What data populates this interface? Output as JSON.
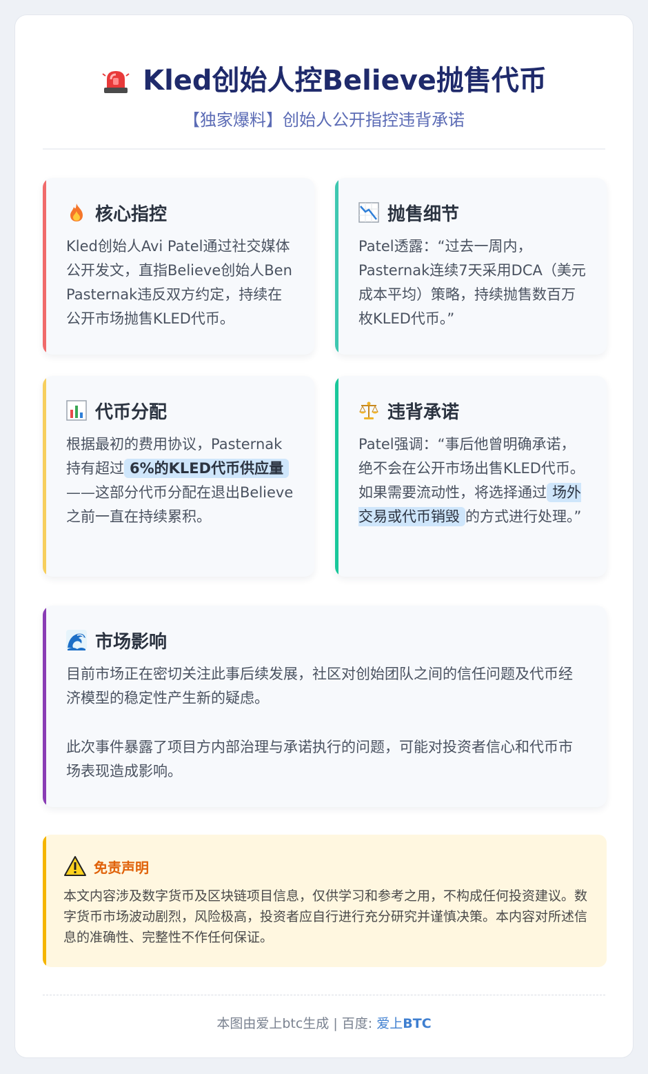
{
  "header": {
    "title": "Kled创始人控Believe抛售代币",
    "subtitle": "【独家爆料】创始人公开指控违背承诺"
  },
  "cards": {
    "accusation": {
      "title": "核心指控",
      "body": "Kled创始人Avi Patel通过社交媒体公开发文，直指Believe创始人Ben Pasternak违反双方约定，持续在公开市场抛售KLED代币。"
    },
    "selling": {
      "title": "抛售细节",
      "body": "Patel透露：“过去一周内，Pasternak连续7天采用DCA（美元成本平均）策略，持续抛售数百万枚KLED代币。”"
    },
    "allocation": {
      "title": "代币分配",
      "body_before": "根据最初的费用协议，Pasternak持有超过",
      "highlight": "6%的KLED代币供应量",
      "body_after": "——这部分代币分配在退出Believe之前一直在持续累积。"
    },
    "promise": {
      "title": "违背承诺",
      "body_before": "Patel强调：“事后他曾明确承诺，绝不会在公开市场出售KLED代币。如果需要流动性，将选择通过",
      "highlight": "场外交易或代币销毁",
      "body_after": "的方式进行处理。”"
    },
    "impact": {
      "title": "市场影响",
      "para1": "目前市场正在密切关注此事后续发展，社区对创始团队之间的信任问题及代币经济模型的稳定性产生新的疑虑。",
      "para2": "此次事件暴露了项目方内部治理与承诺执行的问题，可能对投资者信心和代币市场表现造成影响。"
    }
  },
  "disclaimer": {
    "title": "免责声明",
    "body": "本文内容涉及数字货币及区块链项目信息，仅供学习和参考之用，不构成任何投资建议。数字货币市场波动剧烈，风险极高，投资者应自行进行充分研究并谨慎决策。本内容对所述信息的准确性、完整性不作任何保证。"
  },
  "footer": {
    "prefix": "本图由爱上btc生成 | 百度: ",
    "link_part1": "爱上",
    "link_part2": "BTC"
  },
  "colors": {
    "accusation_accent": "#f06b6b",
    "selling_accent": "#3ec7b0",
    "allocation_accent": "#f7cf5e",
    "promise_accent": "#19c79a",
    "impact_accent": "#8a3db5",
    "disclaimer_accent": "#f5b500"
  },
  "icons": {
    "title": "siren-icon",
    "accusation": "fire-icon",
    "selling": "chart-decreasing-icon",
    "allocation": "bar-chart-icon",
    "promise": "balance-scale-icon",
    "impact": "wave-icon",
    "disclaimer": "warning-icon"
  }
}
